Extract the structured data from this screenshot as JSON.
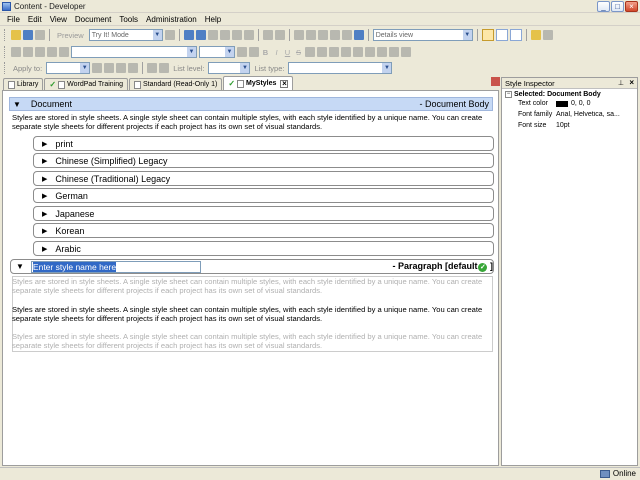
{
  "window": {
    "title": "Content - Developer"
  },
  "menu": [
    "File",
    "Edit",
    "View",
    "Document",
    "Tools",
    "Administration",
    "Help"
  ],
  "toolbar": {
    "preview_label": "Preview",
    "mode_value": "Try It! Mode",
    "view_value": "Details view",
    "apply_to_label": "Apply to:",
    "list_level_label": "List level:",
    "list_type_label": "List type:",
    "bold": "B",
    "italic": "I",
    "underline": "U",
    "strike": "S"
  },
  "tabs": [
    {
      "label": "Library",
      "active": false
    },
    {
      "label": "WordPad Training",
      "active": false
    },
    {
      "label": "Standard (Read-Only 1)",
      "active": false
    },
    {
      "label": "MyStyles",
      "active": true
    }
  ],
  "document": {
    "header_name": "Document",
    "header_type": "- Document Body",
    "description": "Styles are stored in style sheets. A single style sheet can contain multiple styles, with each style identified by a unique name. You can create separate style sheets for different projects if each project has its own set of visual standards.",
    "languages": [
      "print",
      "Chinese (Simplified) Legacy",
      "Chinese (Traditional) Legacy",
      "German",
      "Japanese",
      "Korean",
      "Arabic"
    ],
    "new_style": {
      "name_placeholder": "Enter style name here",
      "type_label": "- Paragraph [default",
      "type_close": "]"
    },
    "preview_texts": [
      "Styles are stored in style sheets. A single style sheet can contain multiple styles, with each style identified by a unique name. You can create separate style sheets for different projects if each project has its own set of visual standards.",
      "Styles are stored in style sheets. A single style sheet can contain multiple styles, with each style identified by a unique name. You can create separate style sheets for different projects if each project has its own set of visual standards.",
      "Styles are stored in style sheets. A single style sheet can contain multiple styles, with each style identified by a unique name. You can create separate style sheets for different projects if each project has its own set of visual standards."
    ]
  },
  "inspector": {
    "title": "Style Inspector",
    "selected": "Selected: Document Body",
    "properties": [
      {
        "name": "Text color",
        "value": "0, 0, 0",
        "swatch": "#000000"
      },
      {
        "name": "Font family",
        "value": "Arial, Helvetica, sa..."
      },
      {
        "name": "Font size",
        "value": "10pt"
      }
    ]
  },
  "status": {
    "connection": "Online"
  },
  "colors": {
    "header_bg": "#c6d9f5",
    "selection": "#3169c6",
    "default_check": "#37a637"
  }
}
